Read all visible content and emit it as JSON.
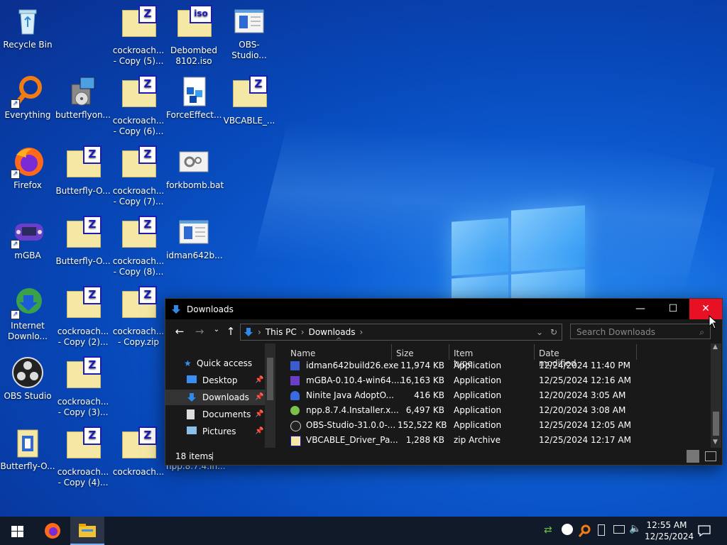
{
  "desktop": {
    "icons": [
      {
        "label": "Recycle Bin",
        "icon": "recycle-bin-icon"
      },
      {
        "label": "Everything",
        "icon": "everything-icon"
      },
      {
        "label": "Firefox",
        "icon": "firefox-icon"
      },
      {
        "label": "mGBA",
        "icon": "mgba-icon"
      },
      {
        "label": "Internet\nDownlo...",
        "icon": "idm-icon"
      },
      {
        "label": "OBS Studio",
        "icon": "obs-icon"
      },
      {
        "label": "Butterfly-O...",
        "icon": "butterfly-icon"
      },
      {
        "label": "butterflyon...",
        "icon": "installer-icon"
      },
      {
        "label": "Butterfly-O...",
        "icon": "zip-folder-icon"
      },
      {
        "label": "Butterfly-O...",
        "icon": "zip-folder-icon"
      },
      {
        "label": "cockroach...\n- Copy (2)...",
        "icon": "zip-folder-icon"
      },
      {
        "label": "cockroach...\n- Copy (3)...",
        "icon": "zip-folder-icon"
      },
      {
        "label": "cockroach...\n- Copy (4)...",
        "icon": "zip-folder-icon"
      },
      {
        "label": "cockroach...\n- Copy (5)...",
        "icon": "zip-folder-icon"
      },
      {
        "label": "cockroach...\n- Copy (6)...",
        "icon": "zip-folder-icon"
      },
      {
        "label": "cockroach...\n- Copy (7)...",
        "icon": "zip-folder-icon"
      },
      {
        "label": "cockroach...\n- Copy (8)...",
        "icon": "zip-folder-icon"
      },
      {
        "label": "cockroach...\n- Copy.zip",
        "icon": "zip-folder-icon"
      },
      {
        "label": "cockroach...",
        "icon": "zip-folder-icon"
      },
      {
        "label": "Debombed\n8102.iso",
        "icon": "iso-icon"
      },
      {
        "label": "ForceEffect...",
        "icon": "forceeffect-icon"
      },
      {
        "label": "forkbomb.bat",
        "icon": "batch-file-icon"
      },
      {
        "label": "idman642b...",
        "icon": "exe-window-icon"
      },
      {
        "label": "npp.8.7.4.In...",
        "icon": "exe-window-icon"
      },
      {
        "label": "OBS-Studio...",
        "icon": "exe-window-icon"
      },
      {
        "label": "VBCABLE_...",
        "icon": "zip-folder-icon"
      }
    ]
  },
  "explorer": {
    "title": "Downloads",
    "controls": {
      "minimize": "—",
      "maximize": "☐",
      "close": "✕"
    },
    "breadcrumb": [
      "This PC",
      "Downloads"
    ],
    "search_placeholder": "Search Downloads",
    "nav": [
      {
        "label": "Quick access",
        "icon": "star-icon"
      },
      {
        "label": "Desktop",
        "icon": "desktop-icon"
      },
      {
        "label": "Downloads",
        "icon": "download-arrow-icon"
      },
      {
        "label": "Documents",
        "icon": "documents-icon"
      },
      {
        "label": "Pictures",
        "icon": "pictures-icon"
      }
    ],
    "columns": [
      "Name",
      "Size",
      "Item type",
      "Date modified"
    ],
    "files": [
      {
        "name": "idman642build26.exe",
        "size": "11,974 KB",
        "type": "Application",
        "date": "12/24/2024 11:40 PM",
        "icon": "idm-file-icon"
      },
      {
        "name": "mGBA-0.10.4-win64....",
        "size": "16,163 KB",
        "type": "Application",
        "date": "12/25/2024 12:16 AM",
        "icon": "mgba-file-icon"
      },
      {
        "name": "Ninite Java AdoptO...",
        "size": "416 KB",
        "type": "Application",
        "date": "12/20/2024 3:05 AM",
        "icon": "ninite-icon"
      },
      {
        "name": "npp.8.7.4.Installer.x...",
        "size": "6,497 KB",
        "type": "Application",
        "date": "12/20/2024 3:08 AM",
        "icon": "npp-icon"
      },
      {
        "name": "OBS-Studio-31.0.0-...",
        "size": "152,522 KB",
        "type": "Application",
        "date": "12/25/2024 12:05 AM",
        "icon": "obs-file-icon"
      },
      {
        "name": "VBCABLE_Driver_Pa...",
        "size": "1,288 KB",
        "type": "zip Archive",
        "date": "12/25/2024 12:17 AM",
        "icon": "zip-file-icon"
      }
    ],
    "status": "18 items"
  },
  "taskbar": {
    "time": "12:55 AM",
    "date": "12/25/2024"
  }
}
